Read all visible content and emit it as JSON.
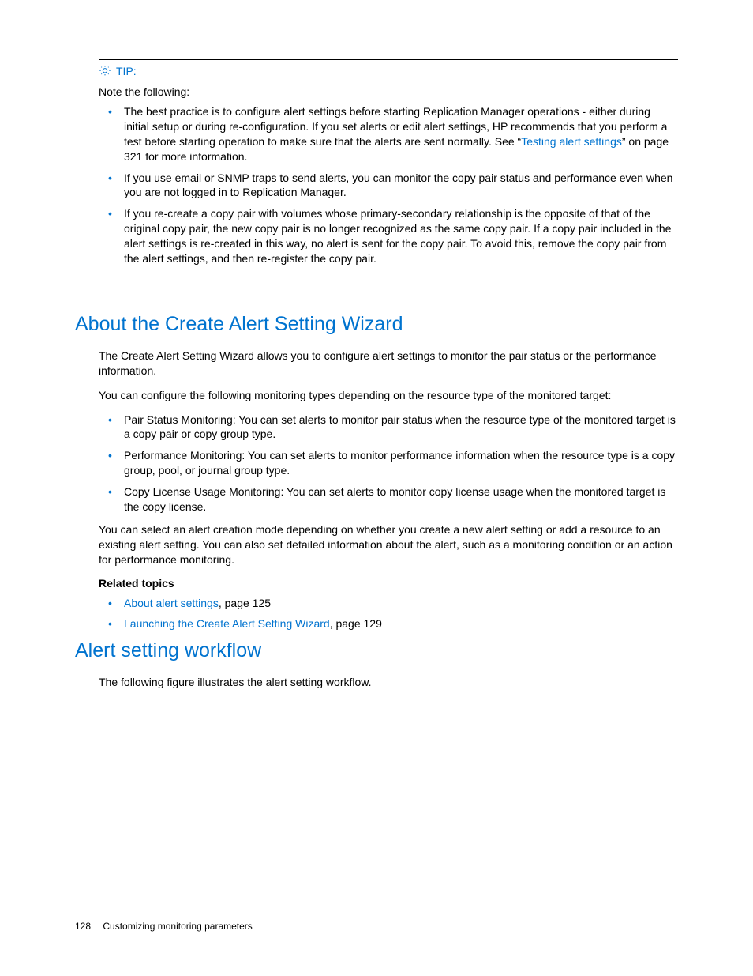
{
  "tip": {
    "label": "TIP:",
    "note": "Note the following:",
    "bullets": [
      {
        "pre": "The best practice is to configure alert settings before starting Replication Manager operations - either during initial setup or during re-configuration. If you set alerts or edit alert settings, HP recommends that you perform a test before starting operation to make sure that the alerts are sent normally. See “",
        "link": "Testing alert settings",
        "post": "” on page 321 for more information."
      },
      {
        "pre": "If you use email or SNMP traps to send alerts, you can monitor the copy pair status and performance even when you are not logged in to Replication Manager.",
        "link": "",
        "post": ""
      },
      {
        "pre": "If you re-create a copy pair with volumes whose primary-secondary relationship is the opposite of that of the original copy pair, the new copy pair is no longer recognized as the same copy pair. If a copy pair included in the alert settings is re-created in this way, no alert is sent for the copy pair. To avoid this, remove the copy pair from the alert settings, and then re-register the copy pair.",
        "link": "",
        "post": ""
      }
    ]
  },
  "section1": {
    "heading": "About the Create Alert Setting Wizard",
    "para1": "The Create Alert Setting Wizard allows you to configure alert settings to monitor the pair status or the performance information.",
    "para2": "You can configure the following monitoring types depending on the resource type of the monitored target:",
    "bullets": [
      "Pair Status Monitoring: You can set alerts to monitor pair status when the resource type of the monitored target is a copy pair or copy group type.",
      "Performance Monitoring: You can set alerts to monitor performance information when the resource type is a copy group, pool, or journal group type.",
      "Copy License Usage Monitoring: You can set alerts to monitor copy license usage when the monitored target is the copy license."
    ],
    "para3": "You can select an alert creation mode depending on whether you create a new alert setting or add a resource to an existing alert setting. You can also set detailed information about the alert, such as a monitoring condition or an action for performance monitoring.",
    "related_heading": "Related topics",
    "related": [
      {
        "link": "About alert settings",
        "suffix": ", page 125"
      },
      {
        "link": "Launching the Create Alert Setting Wizard",
        "suffix": ", page 129"
      }
    ]
  },
  "section2": {
    "heading": "Alert setting workflow",
    "para1": "The following figure illustrates the alert setting workflow."
  },
  "footer": {
    "page": "128",
    "title": "Customizing monitoring parameters"
  }
}
